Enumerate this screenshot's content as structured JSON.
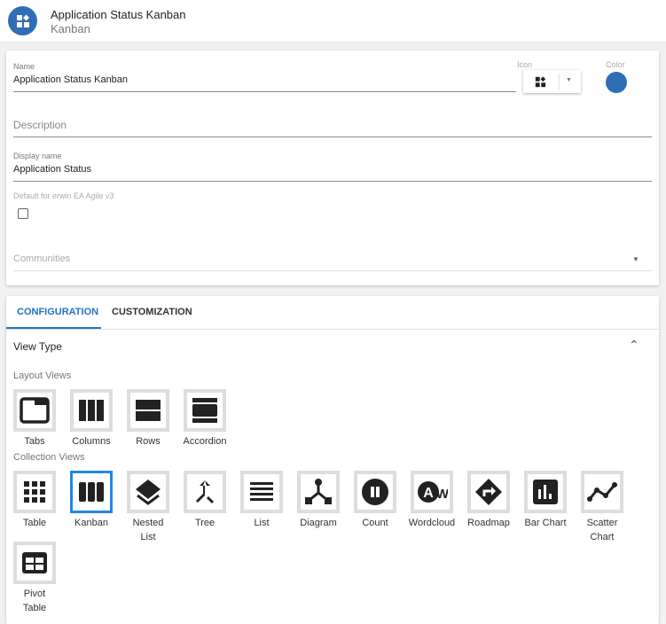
{
  "header": {
    "title": "Application Status Kanban",
    "subtitle": "Kanban"
  },
  "form": {
    "name_label": "Name",
    "name_value": "Application Status Kanban",
    "icon_label": "Icon",
    "color_label": "Color",
    "color_value": "#2f6db5",
    "description_placeholder": "Description",
    "display_name_label": "Display name",
    "display_name_value": "Application Status",
    "default_label": "Default for erwin EA Agile v3",
    "default_checked": false,
    "communities_placeholder": "Communities"
  },
  "tabs": [
    {
      "label": "CONFIGURATION",
      "active": true
    },
    {
      "label": "CUSTOMIZATION",
      "active": false
    }
  ],
  "view_type": {
    "title": "View Type",
    "layout_label": "Layout Views",
    "collection_label": "Collection Views",
    "layout_views": [
      {
        "label": "Tabs",
        "icon": "tabs-icon"
      },
      {
        "label": "Columns",
        "icon": "columns-icon"
      },
      {
        "label": "Rows",
        "icon": "rows-icon"
      },
      {
        "label": "Accordion",
        "icon": "accordion-icon"
      }
    ],
    "collection_views": [
      {
        "label": "Table",
        "icon": "grid-icon"
      },
      {
        "label": "Kanban",
        "icon": "kanban-icon",
        "selected": true
      },
      {
        "label": "Nested List",
        "icon": "layers-icon"
      },
      {
        "label": "Tree",
        "icon": "merge-icon"
      },
      {
        "label": "List",
        "icon": "list-icon"
      },
      {
        "label": "Diagram",
        "icon": "diagram-icon"
      },
      {
        "label": "Count",
        "icon": "count-icon"
      },
      {
        "label": "Wordcloud",
        "icon": "wordcloud-icon"
      },
      {
        "label": "Roadmap",
        "icon": "roadmap-icon"
      },
      {
        "label": "Bar Chart",
        "icon": "bar-chart-icon"
      },
      {
        "label": "Scatter Chart",
        "icon": "scatter-chart-icon"
      },
      {
        "label": "Pivot Table",
        "icon": "pivot-table-icon"
      }
    ]
  }
}
